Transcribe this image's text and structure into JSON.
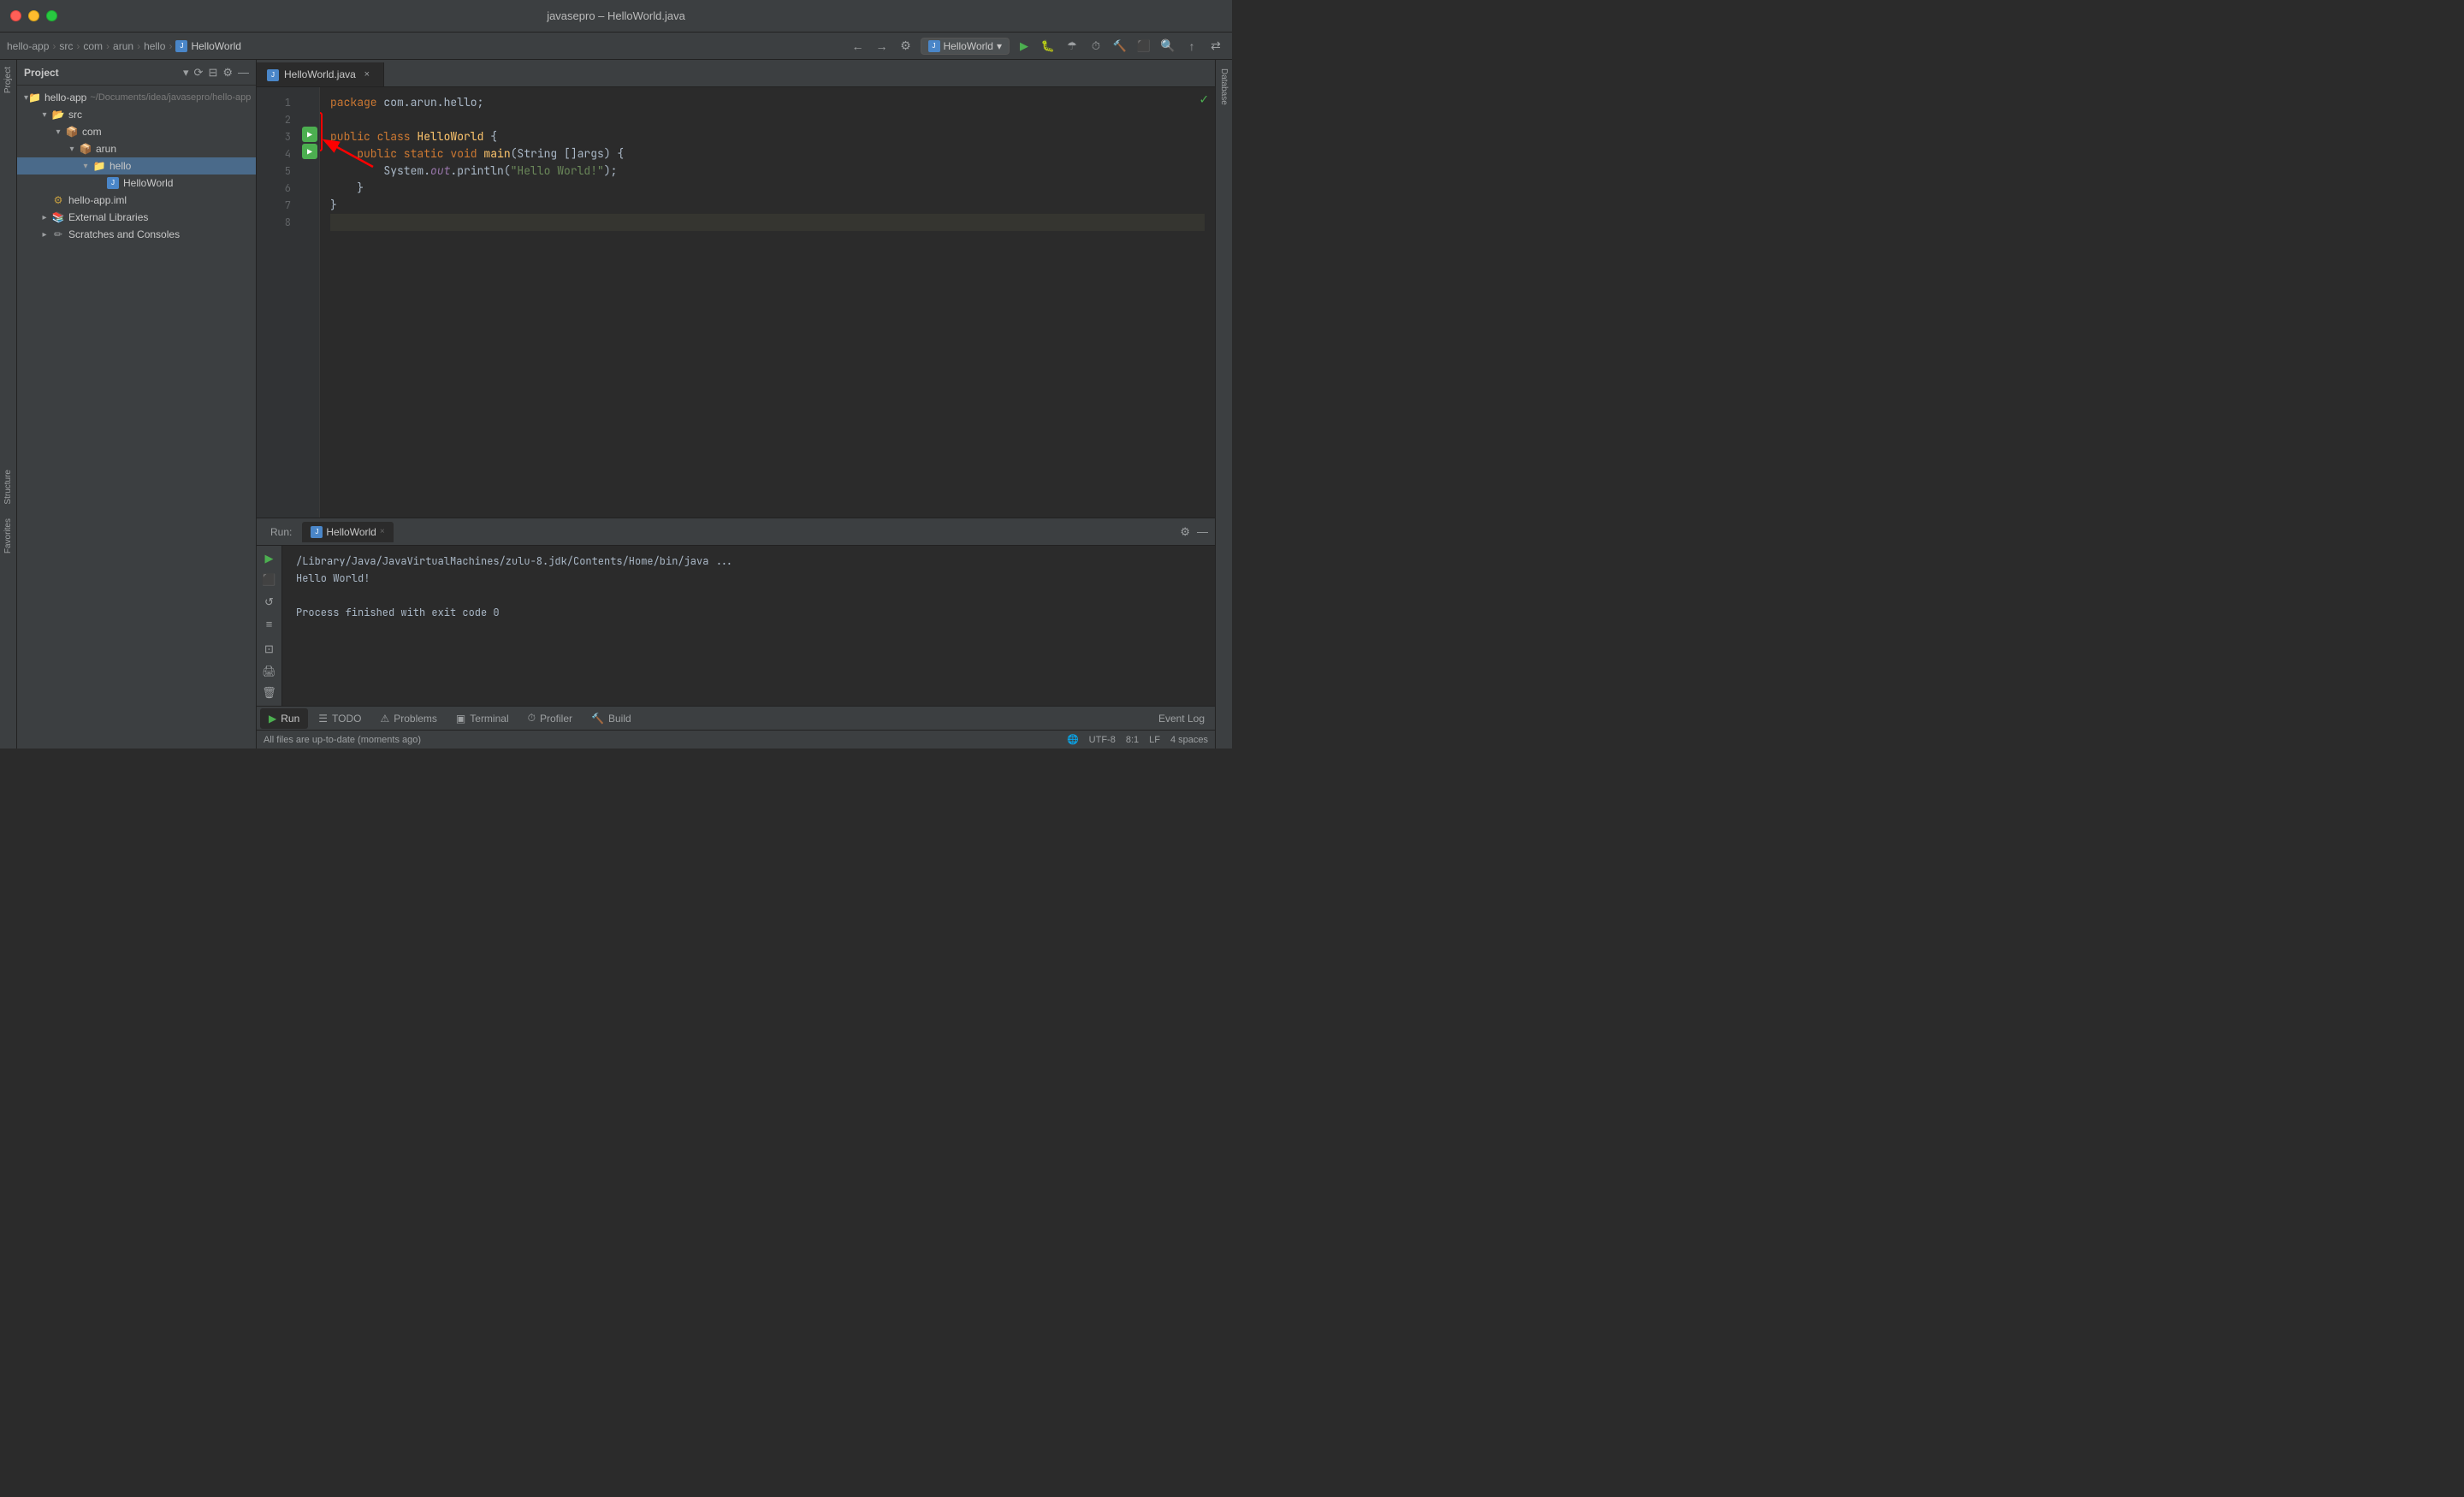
{
  "window": {
    "title": "javasepro – HelloWorld.java",
    "buttons": {
      "close": "×",
      "minimize": "–",
      "maximize": "+"
    }
  },
  "breadcrumb": {
    "items": [
      "hello-app",
      "src",
      "com",
      "arun",
      "hello",
      "HelloWorld"
    ]
  },
  "toolbar": {
    "run_config": "HelloWorld",
    "nav_icons": [
      "←",
      "→"
    ]
  },
  "project_panel": {
    "title": "Project",
    "dropdown": "▾",
    "tree": [
      {
        "label": "hello-app",
        "sublabel": "~/Documents/idea/javasepro/hello-app",
        "level": 0,
        "type": "project",
        "expanded": true
      },
      {
        "label": "src",
        "level": 1,
        "type": "folder",
        "expanded": true
      },
      {
        "label": "com",
        "level": 2,
        "type": "package",
        "expanded": true
      },
      {
        "label": "arun",
        "level": 3,
        "type": "package",
        "expanded": true
      },
      {
        "label": "hello",
        "level": 4,
        "type": "package",
        "expanded": true,
        "selected": true
      },
      {
        "label": "HelloWorld",
        "level": 5,
        "type": "java"
      },
      {
        "label": "hello-app.iml",
        "level": 1,
        "type": "iml"
      },
      {
        "label": "External Libraries",
        "level": 1,
        "type": "libs"
      },
      {
        "label": "Scratches and Consoles",
        "level": 1,
        "type": "scratches"
      }
    ]
  },
  "editor": {
    "tab": {
      "filename": "HelloWorld.java",
      "close": "×"
    },
    "lines": [
      {
        "num": 1,
        "content": "package com.arun.hello;"
      },
      {
        "num": 2,
        "content": ""
      },
      {
        "num": 3,
        "content": "public class HelloWorld {"
      },
      {
        "num": 4,
        "content": "    public static void main(String []args) {"
      },
      {
        "num": 5,
        "content": "        System.out.println(\"Hello World!\");"
      },
      {
        "num": 6,
        "content": "    }"
      },
      {
        "num": 7,
        "content": "}"
      },
      {
        "num": 8,
        "content": ""
      }
    ]
  },
  "run_panel": {
    "label": "Run:",
    "tab": "HelloWorld",
    "tab_close": "×",
    "output": [
      "/Library/Java/JavaVirtualMachines/zulu-8.jdk/Contents/Home/bin/java ...",
      "Hello World!",
      "",
      "Process finished with exit code 0"
    ]
  },
  "bottom_toolbar": {
    "items": [
      {
        "icon": "▶",
        "label": "Run",
        "active": true
      },
      {
        "icon": "☰",
        "label": "TODO"
      },
      {
        "icon": "⚠",
        "label": "Problems"
      },
      {
        "icon": "▣",
        "label": "Terminal"
      },
      {
        "icon": "⏱",
        "label": "Profiler"
      },
      {
        "icon": "🔨",
        "label": "Build"
      }
    ],
    "event_log": "Event Log"
  },
  "status_bar": {
    "left": "All files are up-to-date (moments ago)",
    "right": {
      "encoding": "UTF-8",
      "position": "8:1",
      "line_endings": "LF",
      "indent": "4 spaces"
    }
  },
  "right_sidebar": {
    "label": "Database"
  },
  "left_vert_tabs": [
    "Structure",
    "Favorites"
  ]
}
